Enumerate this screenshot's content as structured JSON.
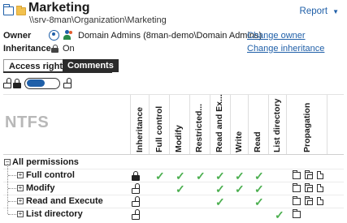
{
  "header": {
    "title": "Marketing",
    "path": "\\\\srv-8man\\Organization\\Marketing",
    "report_label": "Report"
  },
  "owner": {
    "label": "Owner",
    "value": "Domain Admins (8man-demo\\Domain Admins)",
    "change_link": "Change owner"
  },
  "inheritance": {
    "label": "Inheritance",
    "value": "On",
    "change_link": "Change inheritance"
  },
  "tabs": [
    {
      "label": "Access rights",
      "active": true
    },
    {
      "label": "Comments",
      "active": false
    }
  ],
  "grid": {
    "watermark": "NTFS",
    "columns": [
      "Inheritance",
      "Full control",
      "Modify",
      "Restricted...",
      "Read and Ex...",
      "Write",
      "Read",
      "List directory",
      "Propagation"
    ],
    "group_label": "All permissions",
    "rows": [
      {
        "label": "Full control",
        "inheritance": "locked",
        "checks": [
          true,
          true,
          true,
          true,
          true,
          true,
          false
        ],
        "propagation": [
          "folder",
          "subfolders",
          "files"
        ]
      },
      {
        "label": "Modify",
        "inheritance": "unlocked",
        "checks": [
          false,
          true,
          false,
          true,
          true,
          true,
          false
        ],
        "propagation": [
          "folder",
          "subfolders",
          "files"
        ]
      },
      {
        "label": "Read and Execute",
        "inheritance": "unlocked",
        "checks": [
          false,
          false,
          false,
          true,
          false,
          true,
          false
        ],
        "propagation": [
          "folder",
          "subfolders",
          "files"
        ]
      },
      {
        "label": "List directory",
        "inheritance": "unlocked",
        "checks": [
          false,
          false,
          false,
          false,
          false,
          false,
          true
        ],
        "propagation": [
          "folder"
        ]
      }
    ]
  },
  "colors": {
    "accent": "#1f5fa8",
    "check": "#4caf50",
    "tab_dark": "#2b2b2b"
  }
}
